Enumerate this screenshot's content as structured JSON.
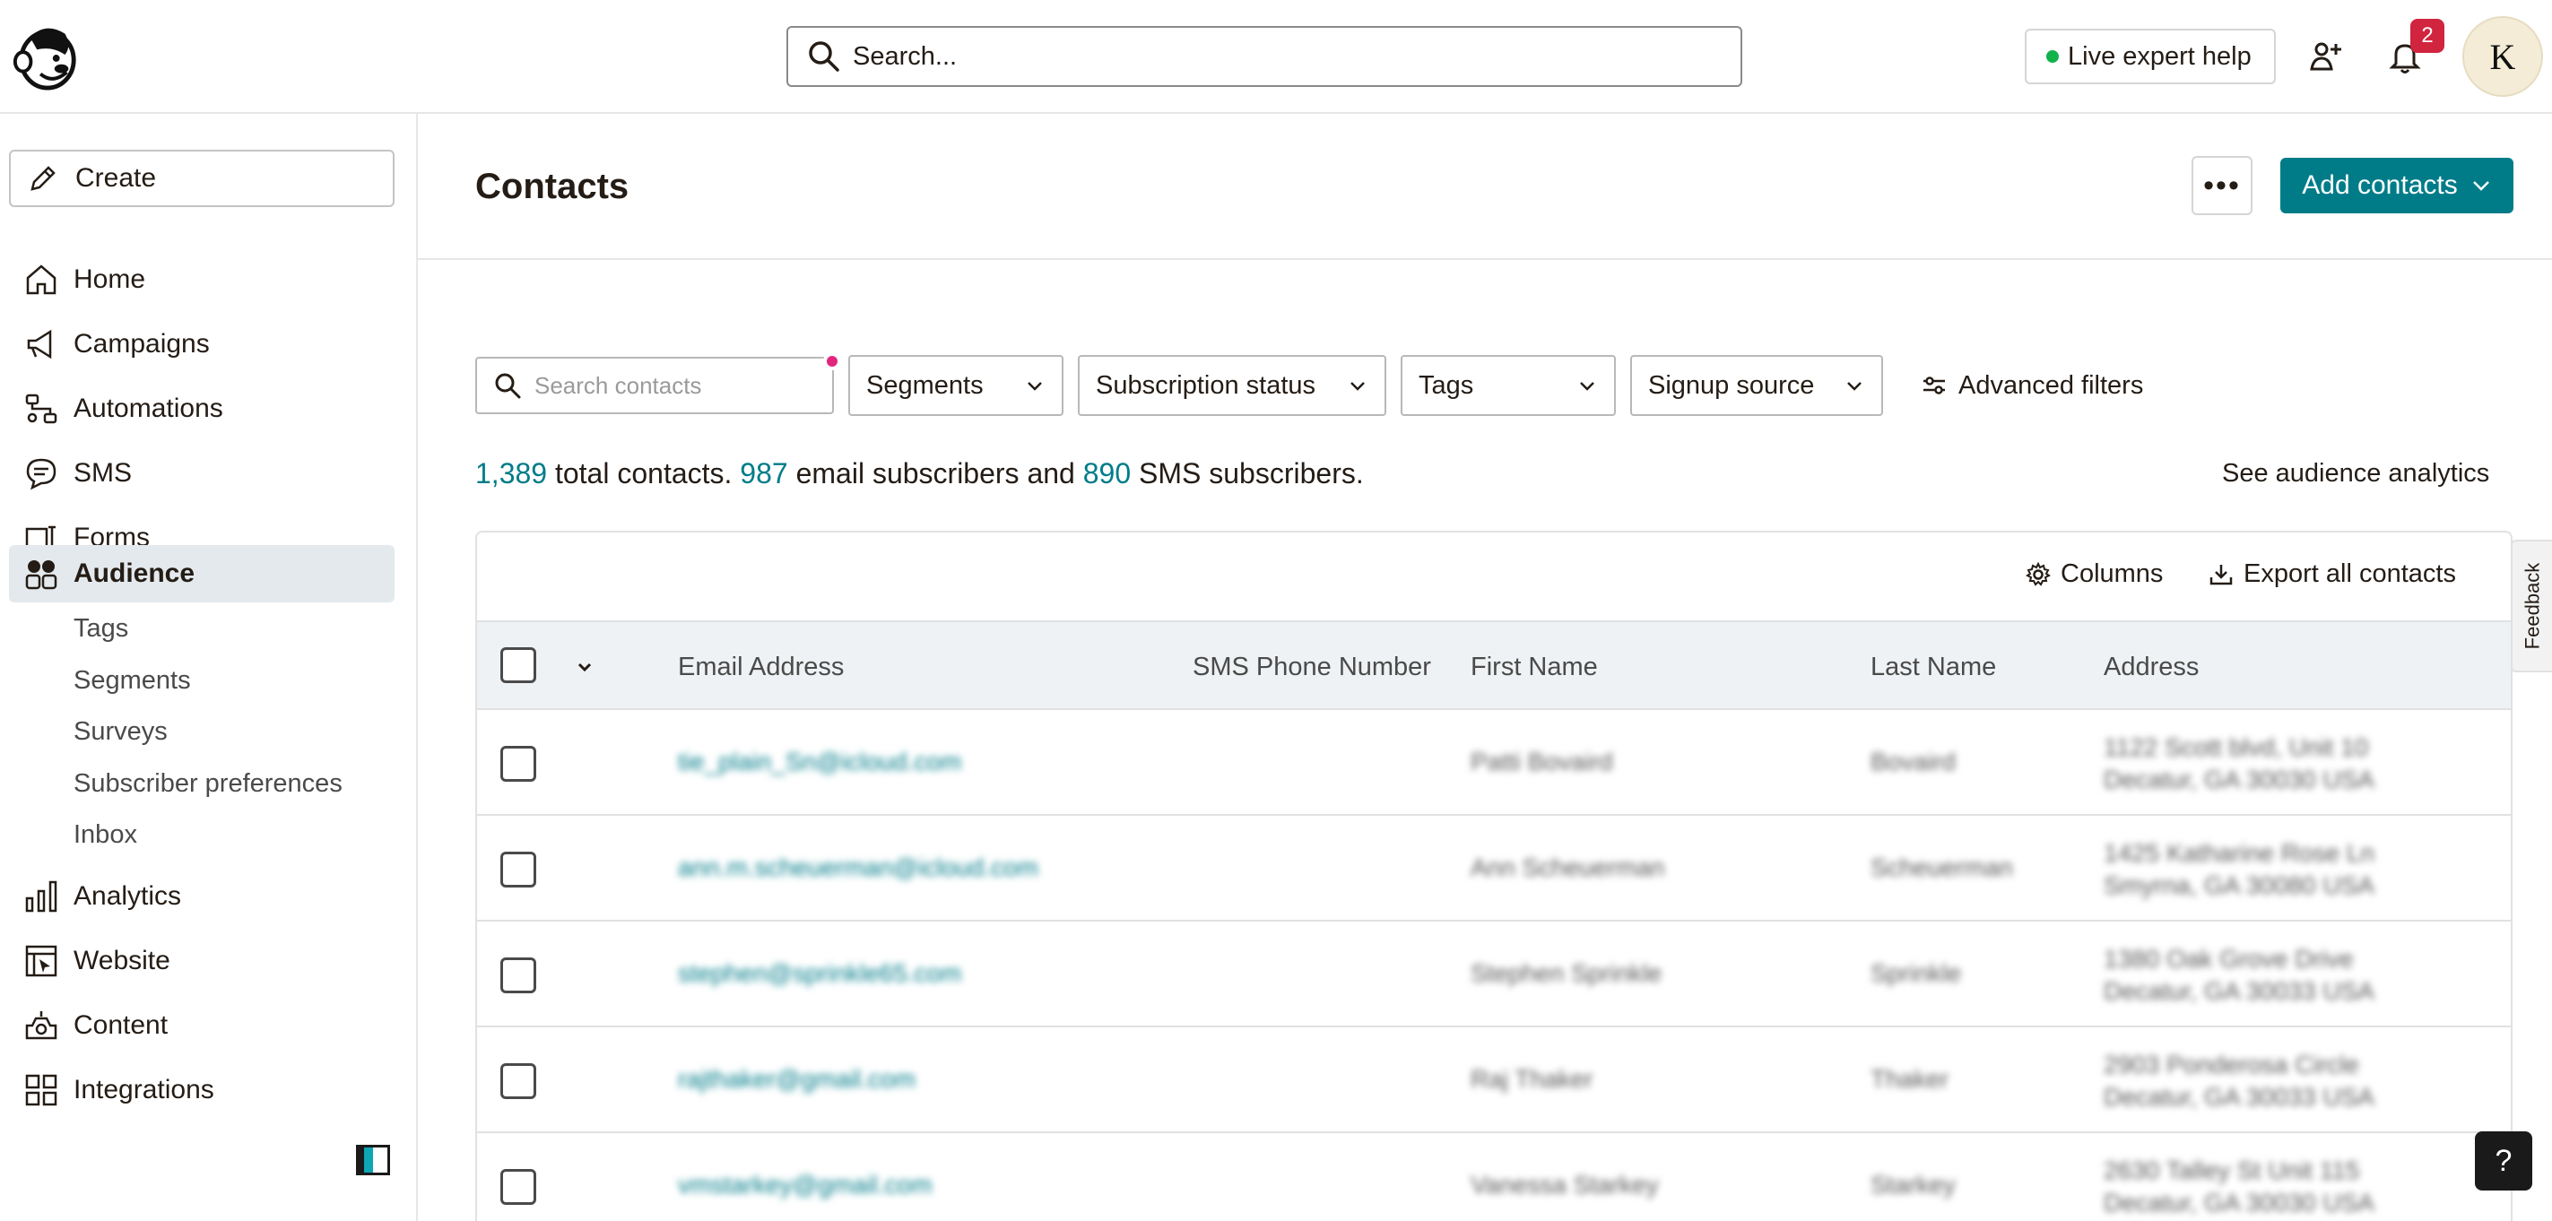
{
  "header": {
    "search_placeholder": "Search...",
    "live_help_label": "Live expert help",
    "notifications_count": "2",
    "avatar_initial": "K"
  },
  "sidebar": {
    "create_label": "Create",
    "items": [
      {
        "label": "Home",
        "icon": "home-icon"
      },
      {
        "label": "Campaigns",
        "icon": "megaphone-icon"
      },
      {
        "label": "Automations",
        "icon": "automation-icon"
      },
      {
        "label": "SMS",
        "icon": "sms-icon"
      },
      {
        "label": "Forms",
        "icon": "forms-icon"
      },
      {
        "label": "Audience",
        "icon": "audience-icon",
        "active": true
      },
      {
        "label": "Analytics",
        "icon": "bar-chart-icon"
      },
      {
        "label": "Website",
        "icon": "website-icon"
      },
      {
        "label": "Content",
        "icon": "content-icon"
      },
      {
        "label": "Integrations",
        "icon": "grid-icon"
      }
    ],
    "audience_sub": [
      "Tags",
      "Segments",
      "Surveys",
      "Subscriber preferences",
      "Inbox"
    ]
  },
  "main": {
    "title": "Contacts",
    "more_label": "•••",
    "add_contacts_label": "Add contacts",
    "filters": {
      "search_placeholder": "Search contacts",
      "segments": "Segments",
      "subscription_status": "Subscription status",
      "tags": "Tags",
      "signup_source": "Signup source",
      "advanced": "Advanced filters"
    },
    "summary": {
      "total": "1,389",
      "total_text": "total contacts.",
      "email": "987",
      "email_text": "email subscribers and",
      "sms": "890",
      "sms_text": "SMS subscribers."
    },
    "see_analytics": "See audience analytics",
    "table": {
      "columns_label": "Columns",
      "export_label": "Export all contacts",
      "headers": [
        "Email Address",
        "SMS Phone Number",
        "First Name",
        "Last Name",
        "Address"
      ],
      "rows": [
        {
          "email": "tie_plain_Sn@icloud.com",
          "phone": "",
          "first": "Patti Bovaird",
          "last": "Bovaird",
          "addr1": "1122 Scott blvd, Unit 10",
          "addr2": "Decatur, GA 30030 USA"
        },
        {
          "email": "ann.m.scheuerman@icloud.com",
          "phone": "",
          "first": "Ann Scheuerman",
          "last": "Scheuerman",
          "addr1": "1425 Katharine Rose Ln",
          "addr2": "Smyrna, GA 30080 USA"
        },
        {
          "email": "stephen@sprinkle65.com",
          "phone": "",
          "first": "Stephen Sprinkle",
          "last": "Sprinkle",
          "addr1": "1380 Oak Grove Drive",
          "addr2": "Decatur, GA 30033 USA"
        },
        {
          "email": "rajthaker@gmail.com",
          "phone": "",
          "first": "Raj Thaker",
          "last": "Thaker",
          "addr1": "2903 Ponderosa Circle",
          "addr2": "Decatur, GA 30033 USA"
        },
        {
          "email": "vmstarkey@gmail.com",
          "phone": "",
          "first": "Vanessa Starkey",
          "last": "Starkey",
          "addr1": "2630 Talley St Unit 115",
          "addr2": "Decatur, GA 30030 USA"
        }
      ]
    }
  },
  "feedback_label": "Feedback",
  "help_label": "?",
  "colors": {
    "accent": "#007c89",
    "active_nav": "#e3e9ec",
    "badge": "#d1243f",
    "pink_dot": "#e2267d"
  }
}
